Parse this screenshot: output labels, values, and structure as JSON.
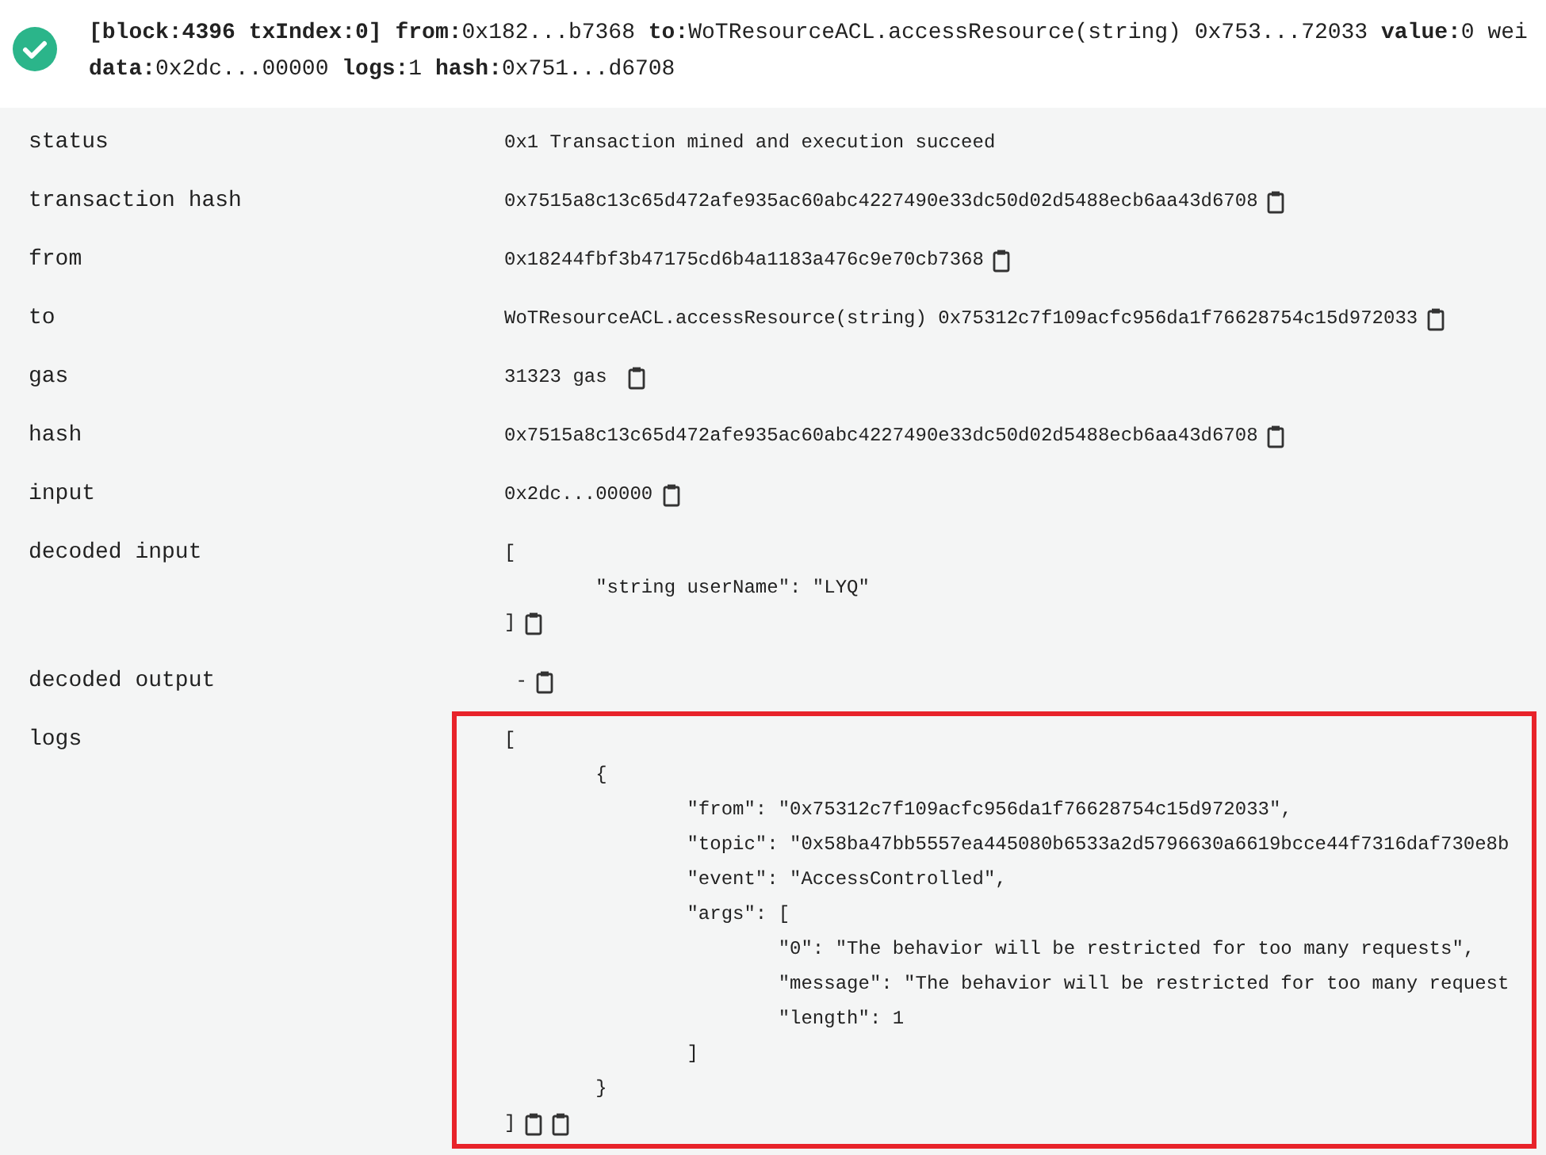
{
  "summary": {
    "lines": [
      "**[block:4396 txIndex:0]** **from:**0x182...b7368 **to:**WoTResourceACL.accessResource(string) 0x753...72033 **value:**0 wei",
      "**data:**0x2dc...00000 **logs:**1 **hash:**0x751...d6708"
    ]
  },
  "rows": [
    {
      "label": "status",
      "kind": "text",
      "lines": [
        "0x1 Transaction mined and execution succeed"
      ],
      "copyable": false,
      "highlighted": false
    },
    {
      "label": "transaction hash",
      "kind": "text",
      "lines": [
        "0x7515a8c13c65d472afe935ac60abc4227490e33dc50d02d5488ecb6aa43d6708"
      ],
      "copyable": true,
      "highlighted": false
    },
    {
      "label": "from",
      "kind": "text",
      "lines": [
        "0x18244fbf3b47175cd6b4a1183a476c9e70cb7368"
      ],
      "copyable": true,
      "highlighted": false
    },
    {
      "label": "to",
      "kind": "text",
      "lines": [
        "WoTResourceACL.accessResource(string) 0x75312c7f109acfc956da1f76628754c15d972033"
      ],
      "copyable": true,
      "highlighted": false
    },
    {
      "label": "gas",
      "kind": "text",
      "lines": [
        "31323 gas "
      ],
      "copyable": true,
      "highlighted": false
    },
    {
      "label": "hash",
      "kind": "text",
      "lines": [
        "0x7515a8c13c65d472afe935ac60abc4227490e33dc50d02d5488ecb6aa43d6708"
      ],
      "copyable": true,
      "highlighted": false
    },
    {
      "label": "input",
      "kind": "text",
      "lines": [
        "0x2dc...00000"
      ],
      "copyable": true,
      "highlighted": false
    },
    {
      "label": "decoded input",
      "kind": "json",
      "lines": [
        "[",
        "        \"string userName\": \"LYQ\"",
        "]"
      ],
      "copyable": true,
      "highlighted": false
    },
    {
      "label": "decoded output",
      "kind": "text",
      "lines": [
        " -"
      ],
      "copyable": true,
      "highlighted": false
    },
    {
      "label": "logs",
      "kind": "log",
      "lines": [
        "[",
        "        {",
        "                \"from\": \"0x75312c7f109acfc956da1f76628754c15d972033\",",
        "                \"topic\": \"0x58ba47bb5557ea445080b6533a2d5796630a6619bcce44f7316daf730e8b",
        "                \"event\": \"AccessControlled\",",
        "                \"args\": [",
        "                        \"0\": \"The behavior will be restricted for too many requests\",",
        "                        \"message\": \"The behavior will be restricted for too many request",
        "                        \"length\": 1",
        "                ]",
        "        }",
        "]"
      ],
      "copyable": true,
      "highlighted": true
    }
  ]
}
